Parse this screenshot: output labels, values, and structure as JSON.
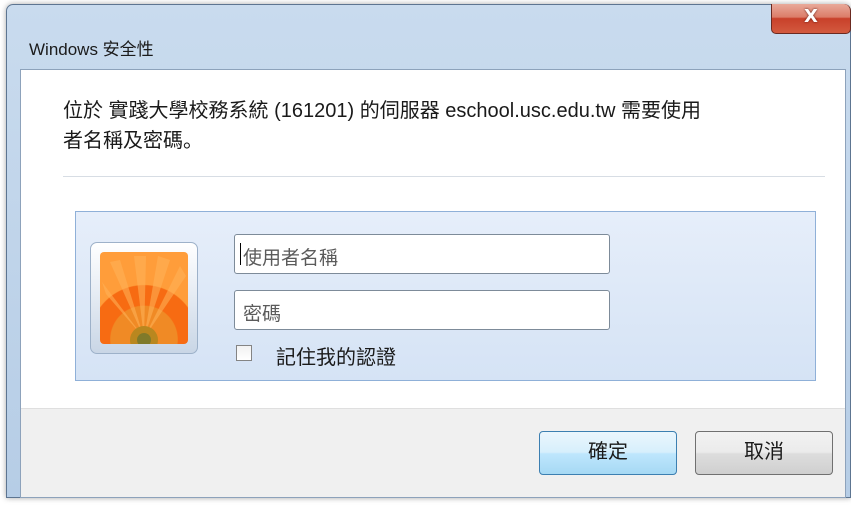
{
  "window": {
    "title": "Windows 安全性",
    "close_label": "X"
  },
  "message": {
    "line1": "位於 實踐大學校務系統 (161201) 的伺服器 eschool.usc.edu.tw 需要使用",
    "line2": "者名稱及密碼。"
  },
  "credentials": {
    "username_placeholder": "使用者名稱",
    "password_placeholder": "密碼",
    "remember_label": "記住我的認證",
    "remember_checked": false
  },
  "buttons": {
    "ok": "確定",
    "cancel": "取消"
  },
  "colors": {
    "title_bar": "#c9dbee",
    "close_button": "#c8402a",
    "panel": "#dbe7f7",
    "ok_border": "#3c7fb1"
  }
}
